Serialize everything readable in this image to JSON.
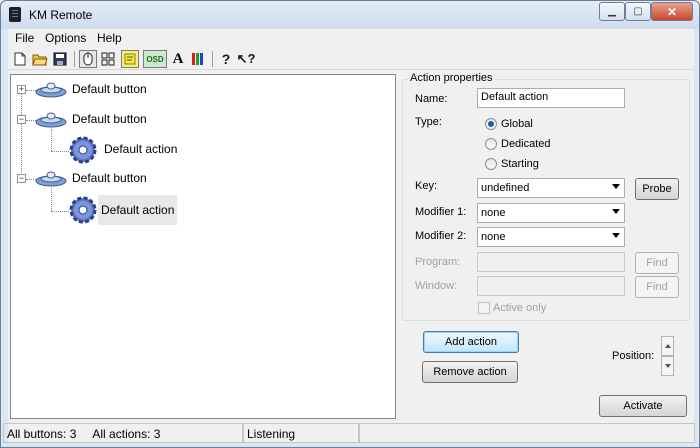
{
  "window": {
    "title": "KM Remote"
  },
  "menu": {
    "items": [
      "File",
      "Options",
      "Help"
    ]
  },
  "toolbar": {
    "buttons": [
      {
        "icon": "new-file-icon"
      },
      {
        "icon": "open-folder-icon"
      },
      {
        "icon": "save-icon"
      },
      {
        "icon": "mouse-icon"
      },
      {
        "icon": "keyboard-grid-icon"
      },
      {
        "icon": "note-icon"
      },
      {
        "icon": "osd-icon",
        "text": "OSD"
      },
      {
        "icon": "font-icon",
        "text": "A"
      },
      {
        "icon": "color-bars-icon"
      },
      {
        "icon": "help-icon",
        "text": "?"
      },
      {
        "icon": "context-help-icon",
        "text": "?"
      }
    ]
  },
  "tree": {
    "nodes": [
      {
        "label": "Default button"
      },
      {
        "label": "Default button"
      },
      {
        "label": "Default action"
      },
      {
        "label": "Default button"
      },
      {
        "label": "Default action"
      }
    ]
  },
  "props": {
    "group_title": "Action properties",
    "name_label": "Name:",
    "name_value": "Default action",
    "type_label": "Type:",
    "type_options": [
      "Global",
      "Dedicated",
      "Starting"
    ],
    "type_selected": "Global",
    "key_label": "Key:",
    "key_value": "undefined",
    "probe_button": "Probe",
    "mod1_label": "Modifier 1:",
    "mod1_value": "none",
    "mod2_label": "Modifier 2:",
    "mod2_value": "none",
    "program_label": "Program:",
    "program_value": "",
    "window_label": "Window:",
    "window_value": "",
    "find_button": "Find",
    "active_only_label": "Active only"
  },
  "actions": {
    "add_action": "Add action",
    "remove_action": "Remove action",
    "position_label": "Position:",
    "activate": "Activate"
  },
  "status": {
    "all_buttons": "All buttons: 3",
    "all_actions": "All actions: 3",
    "state": "Listening"
  }
}
